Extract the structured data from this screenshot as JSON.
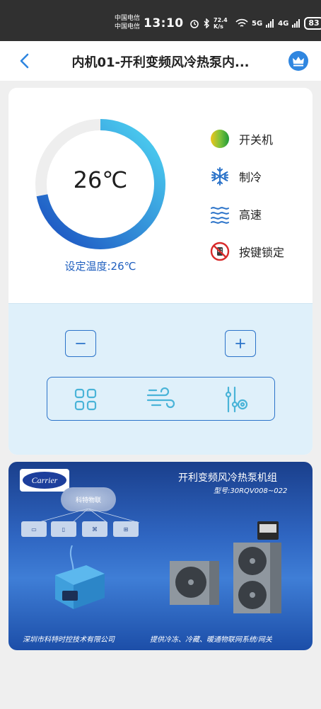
{
  "status_bar": {
    "carrier_1": "中国电信",
    "carrier_2": "中国电信",
    "time": "13:10",
    "net_speed": "72.4 K/s",
    "net_5g": "5G",
    "net_4g": "4G",
    "battery": "83"
  },
  "header": {
    "title": "内机01-开利变频风冷热泵内..."
  },
  "thermostat": {
    "current_temp": "26℃",
    "setpoint_label": "设定温度:26℃",
    "dial_fill_fraction": 0.72,
    "status_items": [
      {
        "icon": "power-status-icon",
        "label": "开关机"
      },
      {
        "icon": "snowflake-icon",
        "label": "制冷"
      },
      {
        "icon": "fan-speed-waves-icon",
        "label": "高速"
      },
      {
        "icon": "key-lock-icon",
        "label": "按键锁定"
      }
    ]
  },
  "controls": {
    "minus_icon": "minus-icon",
    "plus_icon": "plus-icon",
    "functions": [
      {
        "icon": "mode-grid-icon"
      },
      {
        "icon": "wind-icon"
      },
      {
        "icon": "settings-sliders-icon"
      }
    ]
  },
  "banner": {
    "brand": "Carrier",
    "title": "开利变频风冷热泵机组",
    "model": "型号:30RQV008~022",
    "cloud_label": "科特物联",
    "footer_left": "深圳市科特时控技术有限公司",
    "footer_right": "提供冷冻、冷藏、暖通物联网系统/网关"
  },
  "colors": {
    "accent": "#2b73c9",
    "dial_start": "#1a4fc0",
    "dial_end": "#4fd6f3",
    "panel_bg": "#dff0fa"
  }
}
